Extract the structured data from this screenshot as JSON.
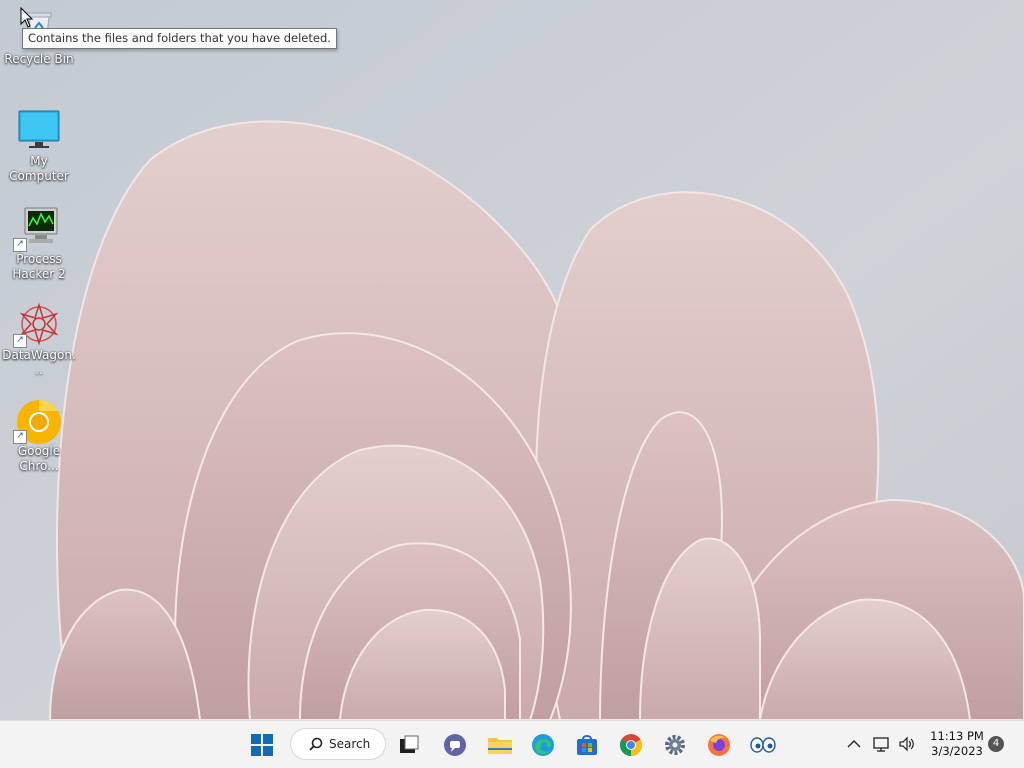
{
  "tooltip": {
    "text": "Contains the files and folders that you have deleted."
  },
  "desktop_icons": [
    {
      "label": "Recycle Bin",
      "icon": "recycle-bin-icon"
    },
    {
      "label": "My Computer",
      "icon": "monitor-icon"
    },
    {
      "label": "Process Hacker 2",
      "icon": "process-hacker-icon"
    },
    {
      "label": "DataWagon...",
      "icon": "datawagon-icon"
    },
    {
      "label": "Google Chro...",
      "icon": "google-chrome-canary-icon"
    }
  ],
  "taskbar": {
    "search_label": "Search",
    "pinned": [
      "start-icon",
      "search-icon",
      "task-view-icon",
      "teams-chat-icon",
      "file-explorer-icon",
      "edge-icon",
      "store-icon",
      "chrome-icon",
      "settings-icon",
      "firefox-icon",
      "eyes-app-icon"
    ],
    "tray": {
      "time": "11:13 PM",
      "date": "3/3/2023",
      "notification_count": "4"
    }
  },
  "colors": {
    "taskbar_bg": "#f3f3f3",
    "wallpaper_bg": "#c9ced4",
    "petal": "#dcc4c4",
    "start_blue": "#0f6cbd"
  }
}
